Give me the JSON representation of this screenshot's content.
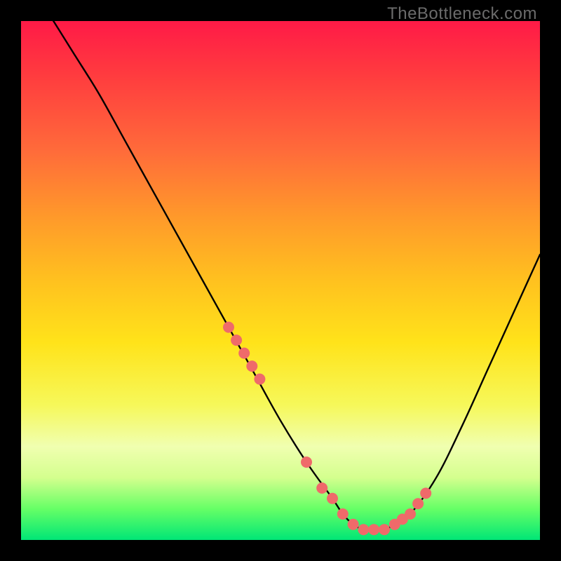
{
  "watermark": "TheBottleneck.com",
  "chart_data": {
    "type": "line",
    "title": "",
    "xlabel": "",
    "ylabel": "",
    "xlim": [
      0,
      100
    ],
    "ylim": [
      0,
      100
    ],
    "curve": {
      "name": "bottleneck-curve",
      "x": [
        0,
        5,
        10,
        15,
        20,
        25,
        30,
        35,
        40,
        45,
        50,
        55,
        60,
        62,
        64,
        66,
        68,
        70,
        72,
        75,
        80,
        85,
        90,
        95,
        100
      ],
      "y": [
        110,
        102,
        94,
        86,
        77,
        68,
        59,
        50,
        41,
        32,
        23,
        15,
        8,
        5,
        3,
        2,
        2,
        2,
        3,
        5,
        12,
        22,
        33,
        44,
        55
      ]
    },
    "markers": {
      "name": "highlight-points",
      "x": [
        40,
        41.5,
        43,
        44.5,
        46,
        55,
        58,
        60,
        62,
        64,
        66,
        68,
        70,
        72,
        73.5,
        75,
        76.5,
        78
      ],
      "y": [
        41,
        38.5,
        36,
        33.5,
        31,
        15,
        10,
        8,
        5,
        3,
        2,
        2,
        2,
        3,
        4,
        5,
        7,
        9
      ]
    }
  }
}
